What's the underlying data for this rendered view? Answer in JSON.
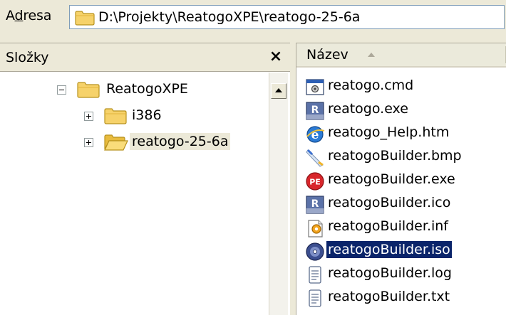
{
  "address": {
    "label_first": "A",
    "label_underlined": "d",
    "label_rest": "resa",
    "value": "D:\\Projekty\\ReatogoXPE\\reatogo-25-6a"
  },
  "folders": {
    "title": "Složky",
    "close_label": "×",
    "tree": [
      {
        "label": "ReatogoXPE",
        "expander": "minus",
        "level": 0
      },
      {
        "label": "i386",
        "expander": "plus",
        "level": 1
      },
      {
        "label": "reatogo-25-6a",
        "expander": "plus",
        "level": 1,
        "selected": true
      }
    ]
  },
  "files": {
    "column_name": "Název",
    "items": [
      {
        "name": "reatogo.cmd",
        "icon": "cmd-script-icon"
      },
      {
        "name": "reatogo.exe",
        "icon": "reatogo-app-icon"
      },
      {
        "name": "reatogo_Help.htm",
        "icon": "ie-htm-icon"
      },
      {
        "name": "reatogoBuilder.bmp",
        "icon": "bitmap-icon"
      },
      {
        "name": "reatogoBuilder.exe",
        "icon": "pe-app-icon"
      },
      {
        "name": "reatogoBuilder.ico",
        "icon": "reatogo-app-icon"
      },
      {
        "name": "reatogoBuilder.inf",
        "icon": "inf-settings-icon"
      },
      {
        "name": "reatogoBuilder.iso",
        "icon": "disc-image-icon",
        "selected": true
      },
      {
        "name": "reatogoBuilder.log",
        "icon": "text-document-icon"
      },
      {
        "name": "reatogoBuilder.txt",
        "icon": "text-document-icon"
      }
    ]
  },
  "colors": {
    "selection": "#0a246a",
    "window": "#ece9d8",
    "folder_yellow": "#f6d26a"
  }
}
